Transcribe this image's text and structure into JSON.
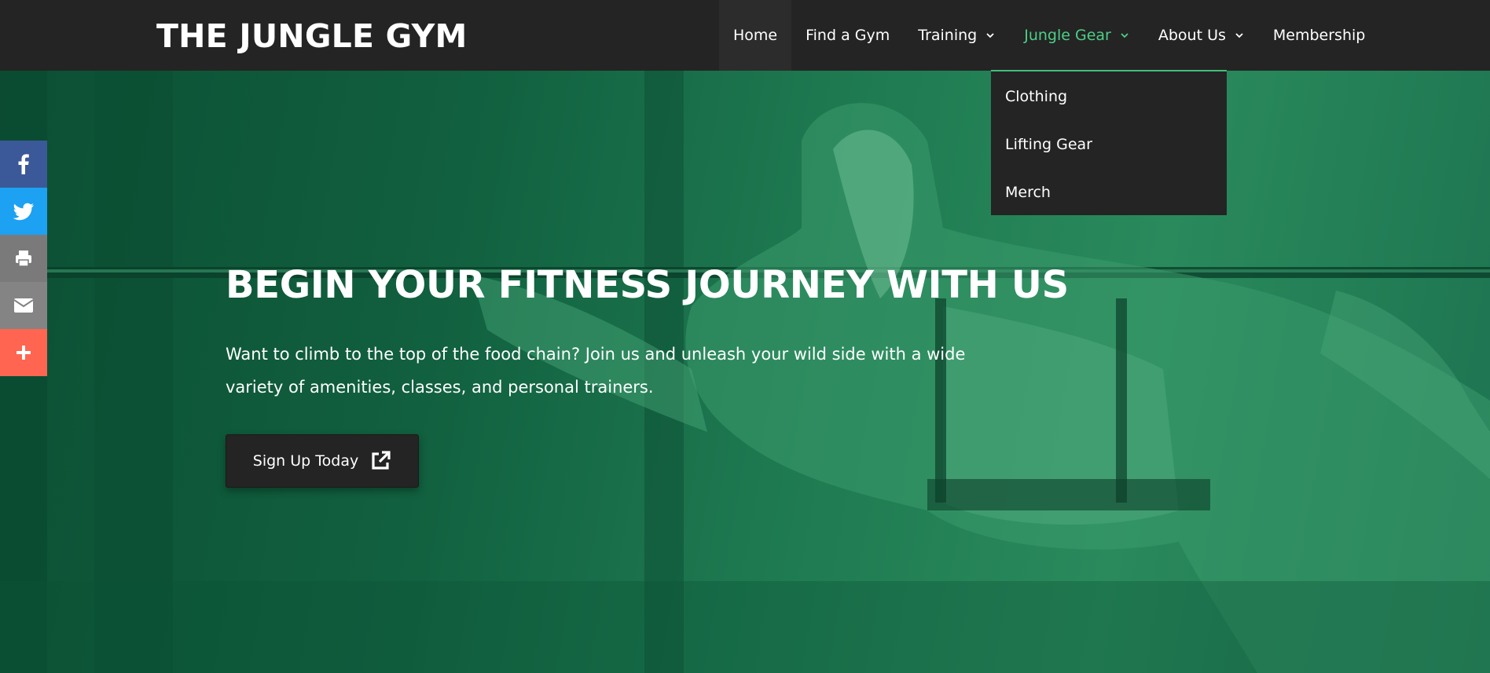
{
  "header": {
    "logo": "THE JUNGLE GYM",
    "nav": [
      {
        "label": "Home"
      },
      {
        "label": "Find a Gym"
      },
      {
        "label": "Training"
      },
      {
        "label": "Jungle Gear"
      },
      {
        "label": "About Us"
      },
      {
        "label": "Membership"
      }
    ]
  },
  "dropdown": {
    "items": [
      "Clothing",
      "Lifting Gear",
      "Merch"
    ]
  },
  "hero": {
    "title": "BEGIN YOUR FITNESS JOURNEY WITH US",
    "text": "Want to climb to the top of the food chain? Join us and unleash your wild side with a wide variety of amenities, classes, and personal trainers.",
    "cta_label": "Sign Up Today"
  },
  "social": {
    "icons": [
      "facebook-icon",
      "twitter-icon",
      "print-icon",
      "email-icon",
      "plus-icon"
    ]
  },
  "colors": {
    "header_bg": "#242424",
    "accent": "#4ccf86",
    "hero_tint": "#1f7b52",
    "facebook": "#3b5998",
    "twitter": "#1da1f2",
    "more": "#ff6550"
  }
}
